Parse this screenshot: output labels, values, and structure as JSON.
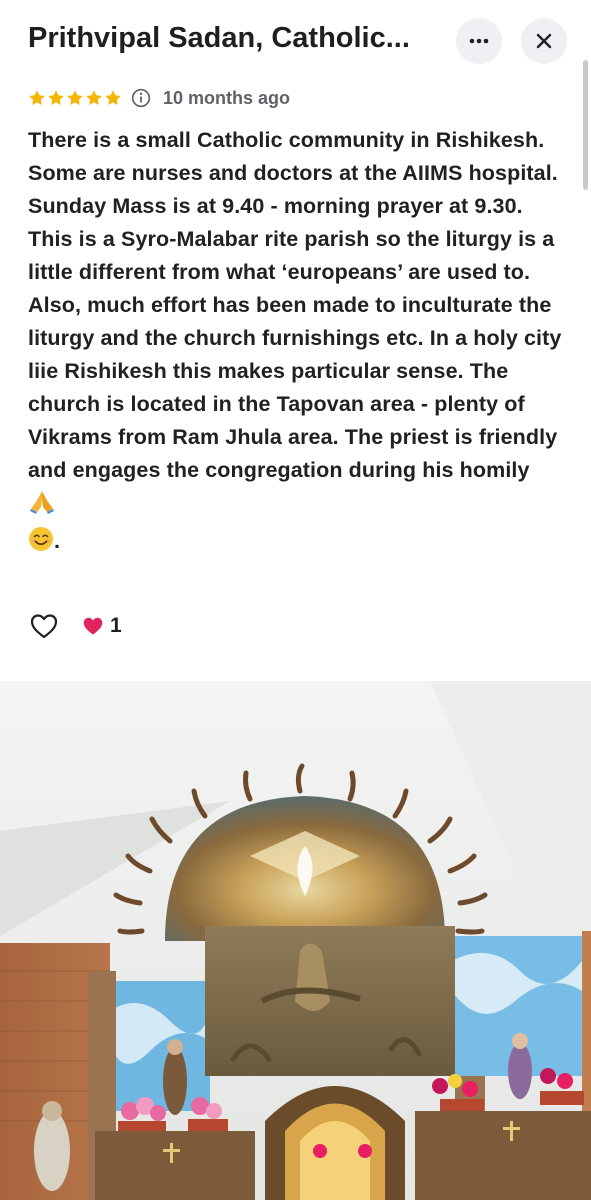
{
  "header": {
    "title": "Prithvipal Sadan, Catholic...",
    "more_icon": "more-horizontal-icon",
    "close_icon": "close-icon"
  },
  "review": {
    "rating": 5,
    "max_rating": 5,
    "time_ago": "10 months ago",
    "paragraph1": "There is a small Catholic community in Rishikesh. Some are nurses and doctors at the AIIMS hospital. Sunday Mass is at 9.40 - morning prayer at 9.30.",
    "paragraph2": "This is a Syro-Malabar rite parish so the liturgy is a little different from what ‘europeans’ are used to. Also, much effort has been made to inculturate the liturgy and the church furnishings etc. In a holy city liie Rishikesh this makes particular sense. The church is located in the Tapovan area - plenty of Vikrams from Ram Jhula area. The priest is friendly and engages the congregation during his homily",
    "emoji_pray": "🙏",
    "emoji_smile": "😊",
    "trailing": "."
  },
  "reactions": {
    "like_icon": "heart-outline-icon",
    "reaction_icon": "red-heart-icon",
    "count": "1"
  },
  "photo": {
    "subject": "church-altar-photo"
  },
  "colors": {
    "star": "#f4b400",
    "meta_gray": "#5f6368",
    "button_bg": "#eef0f3",
    "heart_red": "#e0245e"
  }
}
